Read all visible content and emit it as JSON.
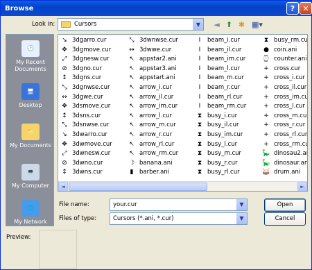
{
  "window": {
    "title": "Browse",
    "help_glyph": "?",
    "close_glyph": "✕"
  },
  "toolbar": {
    "look_in_label": "Look in:",
    "look_in_value": "Cursors",
    "look_in_arrow": "▼",
    "back_glyph": "◄",
    "up_glyph": "⬆",
    "newfolder_glyph": "✱",
    "views_glyph": "▦▾"
  },
  "places": [
    {
      "label": "My Recent Documents",
      "icon": "recent-documents-icon",
      "glyph": "🕑",
      "color": "#e8f0ff"
    },
    {
      "label": "Desktop",
      "icon": "desktop-icon",
      "glyph": "🖥",
      "color": "#3a74d8"
    },
    {
      "label": "My Documents",
      "icon": "my-documents-icon",
      "glyph": "📁",
      "color": "#f4d46b"
    },
    {
      "label": "My Computer",
      "icon": "my-computer-icon",
      "glyph": "💻",
      "color": "#cfd8e6"
    },
    {
      "label": "My Network",
      "icon": "my-network-icon",
      "glyph": "🌐",
      "color": "#4a9ae8"
    }
  ],
  "files": {
    "col1": [
      {
        "name": "3dgarro.cur",
        "g": "↘"
      },
      {
        "name": "3dgmove.cur",
        "g": "✥"
      },
      {
        "name": "3dgnesw.cur",
        "g": "⤢"
      },
      {
        "name": "3dgno.cur",
        "g": "⊘"
      },
      {
        "name": "3dgns.cur",
        "g": "↕"
      },
      {
        "name": "3dgnwse.cur",
        "g": "⤡"
      },
      {
        "name": "3dgwe.cur",
        "g": "↔"
      },
      {
        "name": "3dsmove.cur",
        "g": "✥"
      },
      {
        "name": "3dsns.cur",
        "g": "↕"
      },
      {
        "name": "3dsnwse.cur",
        "g": "⤡"
      },
      {
        "name": "3dwarro.cur",
        "g": "↘"
      },
      {
        "name": "3dwmove.cur",
        "g": "✥"
      },
      {
        "name": "3dwnesw.cur",
        "g": "⤢"
      },
      {
        "name": "3dwno.cur",
        "g": "⊘"
      },
      {
        "name": "3dwns.cur",
        "g": "↕"
      }
    ],
    "col2": [
      {
        "name": "3dwnwse.cur",
        "g": "⤡"
      },
      {
        "name": "3dwwe.cur",
        "g": "↔"
      },
      {
        "name": "appstar2.ani",
        "g": "↖"
      },
      {
        "name": "appstar3.ani",
        "g": "↖"
      },
      {
        "name": "appstart.ani",
        "g": "↖"
      },
      {
        "name": "arrow_i.cur",
        "g": "↖"
      },
      {
        "name": "arrow_il.cur",
        "g": "↖"
      },
      {
        "name": "arrow_im.cur",
        "g": "↖"
      },
      {
        "name": "arrow_l.cur",
        "g": "↖"
      },
      {
        "name": "arrow_m.cur",
        "g": "↖"
      },
      {
        "name": "arrow_r.cur",
        "g": "↖"
      },
      {
        "name": "arrow_rl.cur",
        "g": "↖"
      },
      {
        "name": "arrow_rm.cur",
        "g": "↖"
      },
      {
        "name": "banana.ani",
        "g": "☽"
      },
      {
        "name": "barber.ani",
        "g": "▮"
      }
    ],
    "col3": [
      {
        "name": "beam_i.cur",
        "g": "I"
      },
      {
        "name": "beam_il.cur",
        "g": "I"
      },
      {
        "name": "beam_im.cur",
        "g": "I"
      },
      {
        "name": "beam_l.cur",
        "g": "I"
      },
      {
        "name": "beam_m.cur",
        "g": "I"
      },
      {
        "name": "beam_r.cur",
        "g": "I"
      },
      {
        "name": "beam_rl.cur",
        "g": "I"
      },
      {
        "name": "beam_rm.cur",
        "g": "I"
      },
      {
        "name": "busy_i.cur",
        "g": "⧗"
      },
      {
        "name": "busy_il.cur",
        "g": "⧗"
      },
      {
        "name": "busy_im.cur",
        "g": "⧗"
      },
      {
        "name": "busy_l.cur",
        "g": "⧗"
      },
      {
        "name": "busy_m.cur",
        "g": "⧗"
      },
      {
        "name": "busy_r.cur",
        "g": "⧗"
      },
      {
        "name": "busy_rl.cur",
        "g": "⧗"
      }
    ],
    "col4": [
      {
        "name": "busy_rm.cur",
        "g": "⧗"
      },
      {
        "name": "coin.ani",
        "g": "●"
      },
      {
        "name": "counter.ani",
        "g": "⌚"
      },
      {
        "name": "cross.cur",
        "g": "+"
      },
      {
        "name": "cross_i.cur",
        "g": "+"
      },
      {
        "name": "cross_il.cur",
        "g": "+"
      },
      {
        "name": "cross_im.cur",
        "g": "+"
      },
      {
        "name": "cross_l.cur",
        "g": "+"
      },
      {
        "name": "cross_m.cur",
        "g": "+"
      },
      {
        "name": "cross_r.cur",
        "g": "+"
      },
      {
        "name": "cross_rl.cur",
        "g": "+"
      },
      {
        "name": "cross_rm.cur",
        "g": "+"
      },
      {
        "name": "dinosau2.ani",
        "g": "🦕"
      },
      {
        "name": "dinosaur.ani",
        "g": "🦕"
      },
      {
        "name": "drum.ani",
        "g": "🥁"
      }
    ]
  },
  "scroll": {
    "left_glyph": "◄",
    "right_glyph": "►"
  },
  "form": {
    "file_name_label": "File name:",
    "file_name_value": "your.cur",
    "file_type_label": "Files of type:",
    "file_type_value": "Cursors (*.ani, *.cur)",
    "combo_arrow": "▼",
    "open_label": "Open",
    "cancel_label": "Cancel",
    "preview_label": "Preview:"
  }
}
